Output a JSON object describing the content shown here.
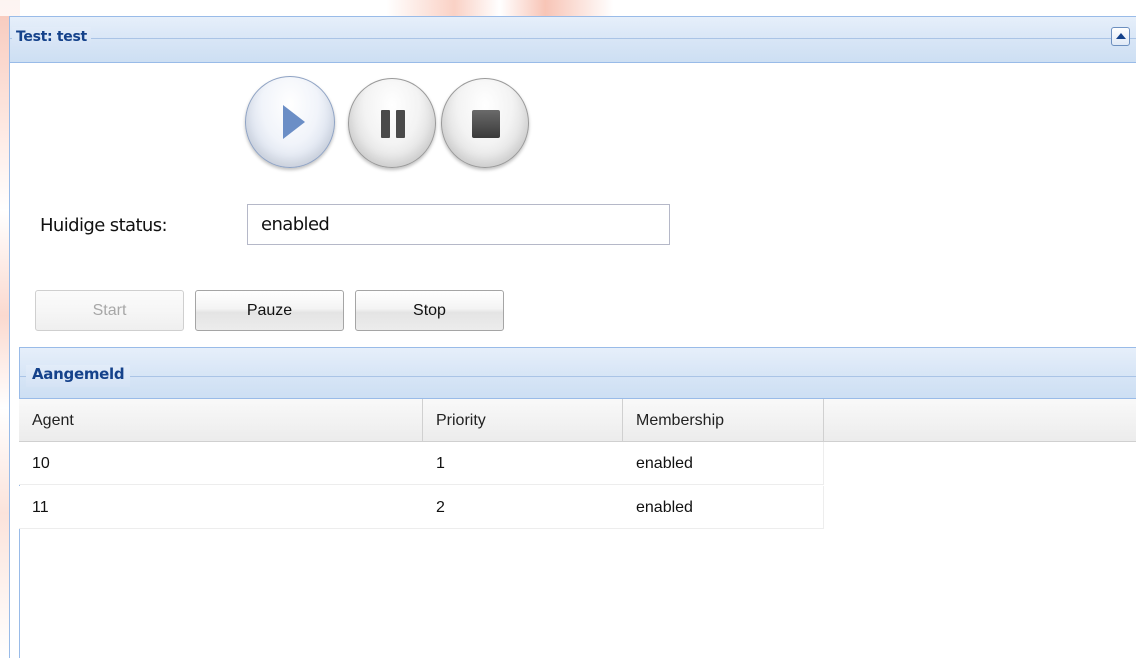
{
  "panel": {
    "title": "Test: test",
    "collapse_icon": "collapse-up-icon"
  },
  "media_controls": {
    "play_icon": "play-icon",
    "pause_icon": "pause-icon",
    "stop_icon": "stop-icon",
    "play_color": "#6b8ec6"
  },
  "status": {
    "label": "Huidige status:",
    "value": "enabled"
  },
  "buttons": {
    "start_label": "Start",
    "pauze_label": "Pauze",
    "stop_label": "Stop",
    "start_disabled": true
  },
  "grid": {
    "title": "Aangemeld",
    "columns": [
      "Agent",
      "Priority",
      "Membership"
    ],
    "rows": [
      {
        "agent": "10",
        "priority": "1",
        "membership": "enabled"
      },
      {
        "agent": "11",
        "priority": "2",
        "membership": "enabled"
      }
    ]
  },
  "theme": {
    "header_text_color": "#15428b",
    "border_color": "#99bbe8"
  }
}
